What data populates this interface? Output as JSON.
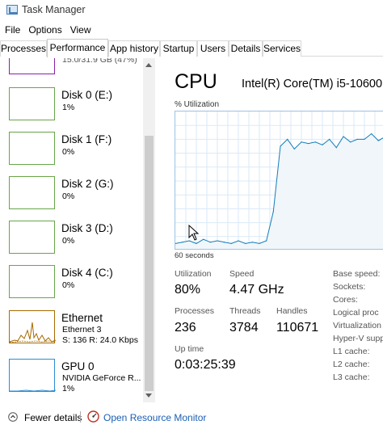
{
  "window": {
    "title": "Task Manager"
  },
  "menu": [
    "File",
    "Options",
    "View"
  ],
  "tabs": [
    {
      "label": "Processes",
      "active": false
    },
    {
      "label": "Performance",
      "active": true
    },
    {
      "label": "App history",
      "active": false
    },
    {
      "label": "Startup",
      "active": false
    },
    {
      "label": "Users",
      "active": false
    },
    {
      "label": "Details",
      "active": false
    },
    {
      "label": "Services",
      "active": false
    }
  ],
  "sidebar": {
    "partial_top_text": "15.0/31.9 GB (47%)",
    "items": [
      {
        "name": "Disk 0 (E:)",
        "line1": "1%",
        "line2": "",
        "kind": "disk"
      },
      {
        "name": "Disk 1 (F:)",
        "line1": "0%",
        "line2": "",
        "kind": "disk"
      },
      {
        "name": "Disk 2 (G:)",
        "line1": "0%",
        "line2": "",
        "kind": "disk"
      },
      {
        "name": "Disk 3 (D:)",
        "line1": "0%",
        "line2": "",
        "kind": "disk"
      },
      {
        "name": "Disk 4 (C:)",
        "line1": "0%",
        "line2": "",
        "kind": "disk"
      },
      {
        "name": "Ethernet",
        "line1": "Ethernet 3",
        "line2": "S: 136 R: 24.0 Kbps",
        "kind": "net"
      },
      {
        "name": "GPU 0",
        "line1": "NVIDIA GeForce R...",
        "line2": "1%",
        "kind": "gpu"
      }
    ]
  },
  "cpu": {
    "title": "CPU",
    "model": "Intel(R) Core(TM) i5-10600K",
    "util_label": "% Utilization",
    "seconds_label": "60 seconds",
    "graph_color": "#117dbb",
    "graph_fill": "#f1f6fa",
    "stats": {
      "utilization": {
        "label": "Utilization",
        "value": "80%"
      },
      "speed": {
        "label": "Speed",
        "value": "4.47 GHz"
      },
      "processes": {
        "label": "Processes",
        "value": "236"
      },
      "threads": {
        "label": "Threads",
        "value": "3784"
      },
      "handles": {
        "label": "Handles",
        "value": "110671"
      },
      "uptime": {
        "label": "Up time",
        "value": "0:03:25:39"
      }
    },
    "side_labels": [
      "Base speed:",
      "Sockets:",
      "Cores:",
      "Logical proc",
      "Virtualization",
      "Hyper-V supp",
      "L1 cache:",
      "L2 cache:",
      "L3 cache:"
    ]
  },
  "chart_data": {
    "type": "area",
    "title": "",
    "xlabel": "60 seconds",
    "ylabel": "% Utilization",
    "ylim": [
      0,
      100
    ],
    "x": [
      60,
      58,
      56,
      54,
      52,
      50,
      48,
      46,
      44,
      42,
      40,
      38,
      36,
      34,
      32,
      30,
      28,
      26,
      24,
      22,
      20,
      18,
      16,
      14,
      12,
      10,
      8,
      6,
      4,
      2,
      0
    ],
    "values": [
      5,
      6,
      7,
      5,
      8,
      6,
      7,
      6,
      5,
      7,
      5,
      6,
      5,
      7,
      28,
      75,
      80,
      73,
      78,
      77,
      78,
      76,
      80,
      74,
      82,
      78,
      80,
      80,
      84,
      79,
      82
    ],
    "series": [
      {
        "name": "",
        "values": [
          5,
          6,
          7,
          5,
          8,
          6,
          7,
          6,
          5,
          7,
          5,
          6,
          5,
          7,
          28,
          75,
          80,
          73,
          78,
          77,
          78,
          76,
          80,
          74,
          82,
          78,
          80,
          80,
          84,
          79,
          82
        ]
      }
    ]
  },
  "bottom": {
    "fewer_details": "Fewer details",
    "open_monitor": "Open Resource Monitor"
  },
  "colors": {
    "disk": "#68a54a",
    "net": "#a76a00",
    "gpu": "#2a8dd4",
    "memory": "#8b1fa8",
    "link": "#1a5fb4"
  }
}
